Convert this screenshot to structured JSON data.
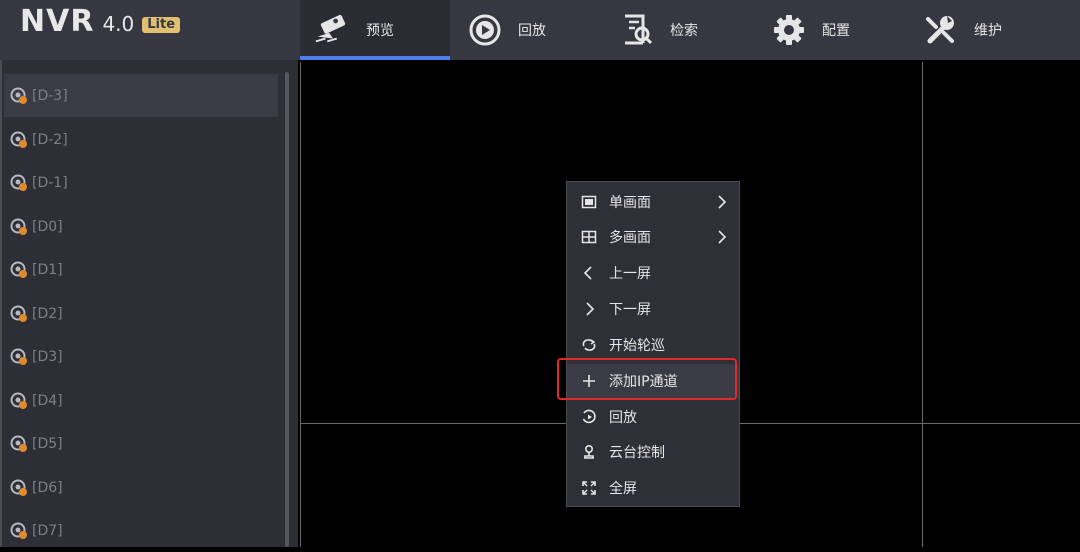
{
  "app": {
    "name": "NVR",
    "version": "4.0",
    "edition": "Lite"
  },
  "nav": [
    {
      "label": "预览",
      "icon": "camera-icon",
      "active": true
    },
    {
      "label": "回放",
      "icon": "playback-icon",
      "active": false
    },
    {
      "label": "检索",
      "icon": "search-file-icon",
      "active": false
    },
    {
      "label": "配置",
      "icon": "gear-icon",
      "active": false
    },
    {
      "label": "维护",
      "icon": "wrench-icon",
      "active": false
    }
  ],
  "channels": [
    "[D-3]",
    "[D-2]",
    "[D-1]",
    "[D0]",
    "[D1]",
    "[D2]",
    "[D3]",
    "[D4]",
    "[D5]",
    "[D6]",
    "[D7]"
  ],
  "context_menu": [
    {
      "label": "单画面",
      "icon": "single-screen-icon",
      "submenu": true
    },
    {
      "label": "多画面",
      "icon": "multi-screen-icon",
      "submenu": true
    },
    {
      "label": "上一屏",
      "icon": "chevron-left-icon",
      "submenu": false
    },
    {
      "label": "下一屏",
      "icon": "chevron-right-icon",
      "submenu": false
    },
    {
      "label": "开始轮巡",
      "icon": "loop-icon",
      "submenu": false
    },
    {
      "label": "添加IP通道",
      "icon": "plus-icon",
      "submenu": false,
      "highlighted": true
    },
    {
      "label": "回放",
      "icon": "playback-icon",
      "submenu": false
    },
    {
      "label": "云台控制",
      "icon": "ptz-icon",
      "submenu": false
    },
    {
      "label": "全屏",
      "icon": "fullscreen-icon",
      "submenu": false
    }
  ],
  "colors": {
    "accent": "#4a7ee8",
    "highlight_box": "#e02a2a",
    "topbar": "#363740",
    "sidebar": "#2d2e36"
  }
}
